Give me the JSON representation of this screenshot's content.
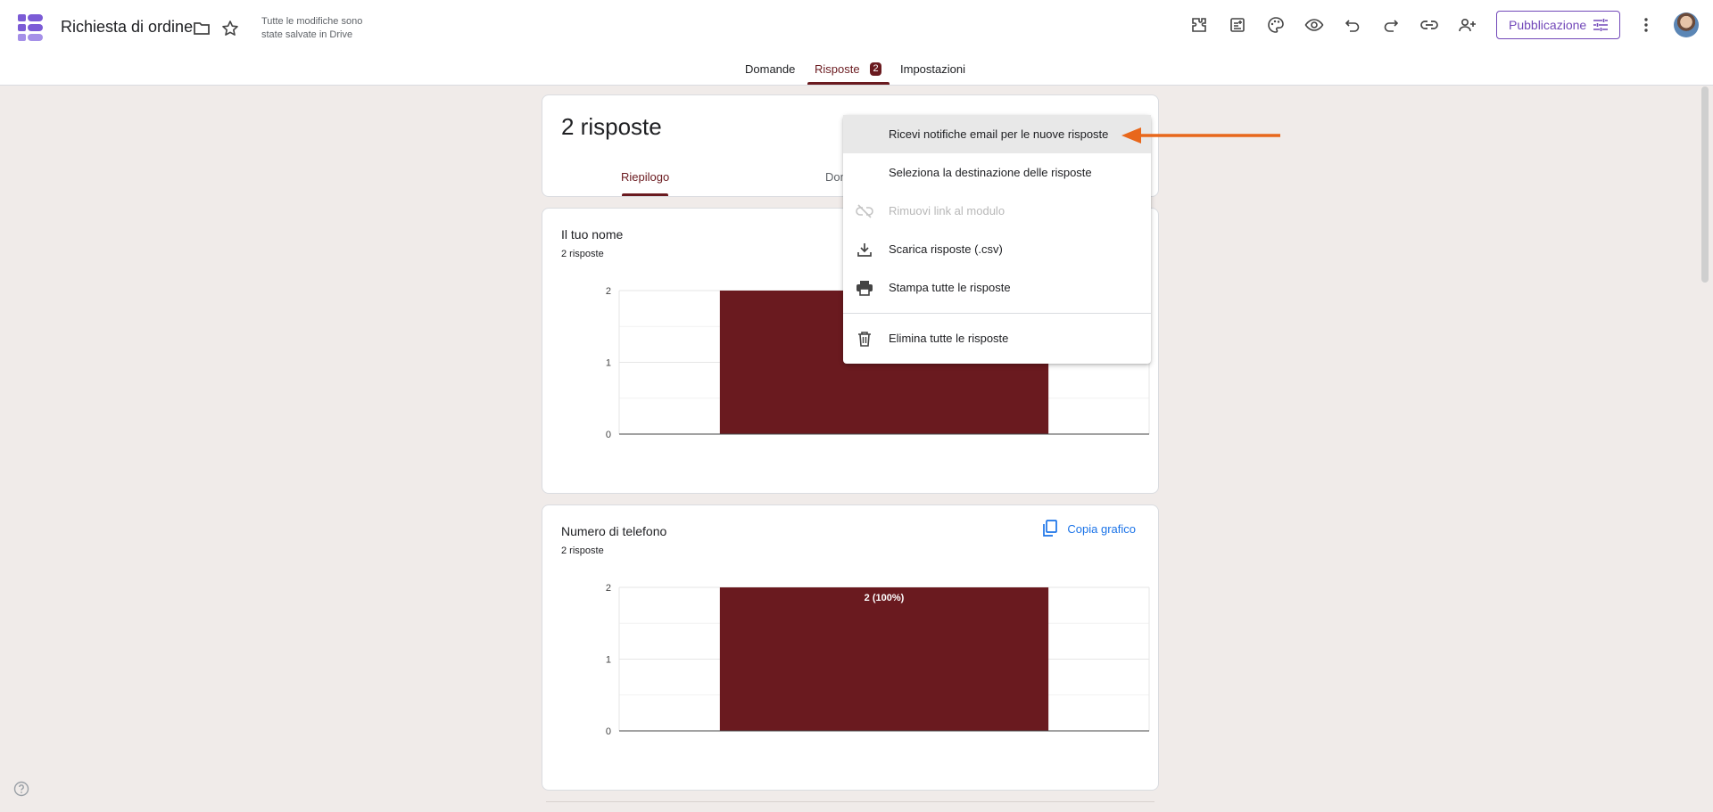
{
  "header": {
    "doc_title": "Richiesta di ordine",
    "save_status_line1": "Tutte le modifiche sono",
    "save_status_line2": "state salvate in Drive",
    "publish_label": "Pubblicazione",
    "icons": [
      "addons-icon",
      "template-icon",
      "palette-icon",
      "preview-icon",
      "undo-icon",
      "redo-icon",
      "link-icon",
      "add-collaborator-icon",
      "more-icon"
    ]
  },
  "tabs": {
    "questions": "Domande",
    "responses": "Risposte",
    "responses_count": "2",
    "settings": "Impostazioni"
  },
  "summary": {
    "title": "2 risposte",
    "tab_summary": "Riepilogo",
    "tab_partial": "Dom"
  },
  "menu": {
    "items": [
      {
        "label": "Ricevi notifiche email per le nuove risposte",
        "icon": "",
        "highlighted": true
      },
      {
        "label": "Seleziona la destinazione delle risposte",
        "icon": ""
      },
      {
        "label": "Rimuovi link al modulo",
        "icon": "unlink-icon",
        "disabled": true
      },
      {
        "label": "Scarica risposte (.csv)",
        "icon": "download-icon"
      },
      {
        "label": "Stampa tutte le risposte",
        "icon": "print-icon"
      },
      {
        "label": "Elimina tutte le risposte",
        "icon": "trash-icon"
      }
    ]
  },
  "questions": [
    {
      "title": "Il tuo nome",
      "count": "2 risposte"
    },
    {
      "title": "Numero di telefono",
      "count": "2 risposte",
      "copy_label": "Copia grafico"
    }
  ],
  "chart_data": [
    {
      "type": "bar",
      "categories": [
        ""
      ],
      "values": [
        2
      ],
      "ylim": [
        0,
        2
      ],
      "yticks": [
        "0",
        "1",
        "2"
      ],
      "bar_color": "#6a1a1f",
      "data_labels": []
    },
    {
      "type": "bar",
      "categories": [
        ""
      ],
      "values": [
        2
      ],
      "ylim": [
        0,
        2
      ],
      "yticks": [
        "0",
        "1",
        "2"
      ],
      "bar_color": "#6a1a1f",
      "data_labels": [
        "2 (100%)"
      ]
    }
  ],
  "colors": {
    "accent": "#6a1a1f",
    "brand": "#7248b9",
    "link": "#1a73e8",
    "arrow": "#e8671b"
  }
}
